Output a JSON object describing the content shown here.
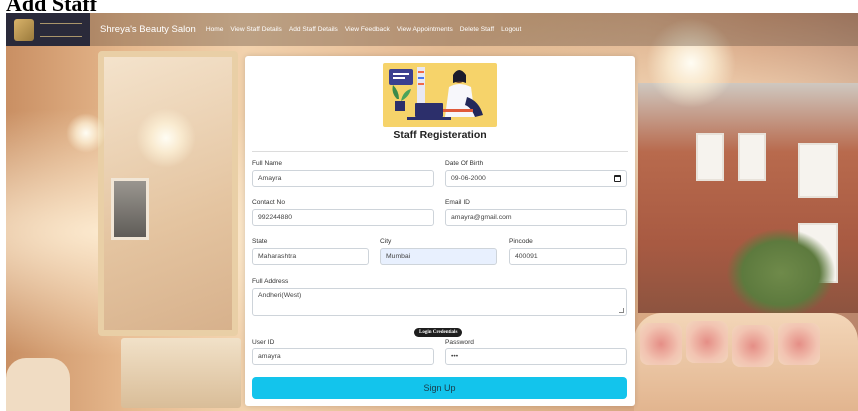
{
  "page": {
    "heading": "Add Staff"
  },
  "navbar": {
    "brand": "Shreya's Beauty Salon",
    "links": [
      "Home",
      "View Staff Details",
      "Add Staff Details",
      "View Feedback",
      "View Appointments",
      "Delete Staff",
      "Logout"
    ]
  },
  "form": {
    "title": "Staff Registeration",
    "full_name": {
      "label": "Full Name",
      "value": "Amayra"
    },
    "dob": {
      "label": "Date Of Birth",
      "value": "09-06-2000"
    },
    "contact": {
      "label": "Contact No",
      "value": "992244880"
    },
    "email": {
      "label": "Email ID",
      "value": "amayra@gmail.com"
    },
    "state": {
      "label": "State",
      "value": "Maharashtra"
    },
    "city": {
      "label": "City",
      "value": "Mumbai"
    },
    "pincode": {
      "label": "Pincode",
      "value": "400091"
    },
    "address": {
      "label": "Full Address",
      "value": "Andheri(West)"
    },
    "credentials_badge": "Login Credentials",
    "user_id": {
      "label": "User ID",
      "value": "amayra"
    },
    "password": {
      "label": "Password",
      "value": "•••"
    },
    "submit_label": "Sign Up"
  },
  "colors": {
    "accent": "#13c4ec",
    "illustration_bg": "#f6d36a",
    "autofill": "#e8f0fe"
  }
}
